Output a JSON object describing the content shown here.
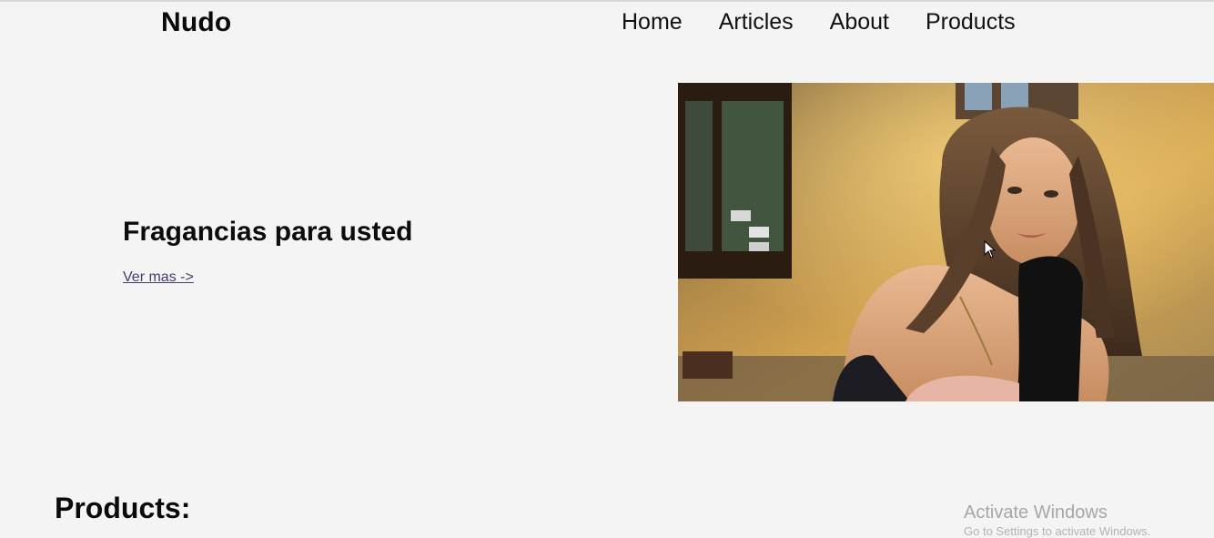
{
  "header": {
    "brand": "Nudo",
    "nav": [
      "Home",
      "Articles",
      "About",
      "Products"
    ]
  },
  "hero": {
    "title": "Fragancias para usted",
    "link_label": "Ver mas ->",
    "image_alt": "woman-portrait-photo"
  },
  "products": {
    "heading": "Products:"
  },
  "os_overlay": {
    "activate_title": "Activate Windows",
    "activate_sub": "Go to Settings to activate Windows."
  },
  "colors": {
    "background": "#f4f4f4",
    "link": "#4a3a6e",
    "text": "#111111"
  }
}
